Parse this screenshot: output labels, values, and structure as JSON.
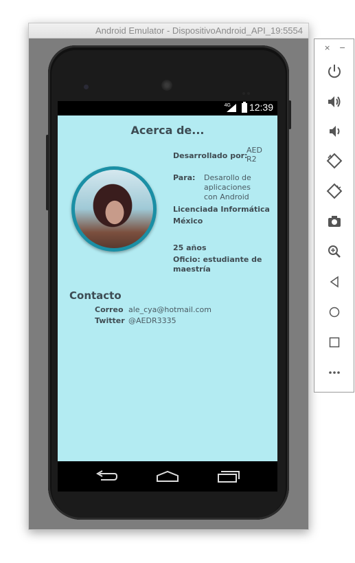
{
  "window": {
    "title": "Android Emulator - DispositivoAndroid_API_19:5554"
  },
  "status_bar": {
    "network": "4G",
    "time": "12:39"
  },
  "screen": {
    "title": "Acerca de...",
    "developed_by_label": "Desarrollado por:",
    "developed_by_value": "AED R2",
    "for_label": "Para:",
    "for_value": "Desarollo de aplicaciones con Android",
    "degree": "Licenciada Informática",
    "country": "México",
    "age": "25 años",
    "occupation": "Oficio: estudiante de maestría"
  },
  "contact": {
    "heading": "Contacto",
    "email_label": "Correo",
    "email_value": "ale_cya@hotmail.com",
    "twitter_label": "Twitter",
    "twitter_value": "@AEDR3335"
  },
  "sidebar": {
    "close": "×",
    "minimize": "−",
    "buttons": [
      "power-icon",
      "volume-up-icon",
      "volume-down-icon",
      "rotate-left-icon",
      "rotate-right-icon",
      "camera-icon",
      "zoom-icon",
      "back-icon",
      "home-icon",
      "overview-icon",
      "more-icon"
    ]
  },
  "colors": {
    "screen_bg": "#b3ebf2",
    "avatar_ring": "#1a8fa5"
  }
}
